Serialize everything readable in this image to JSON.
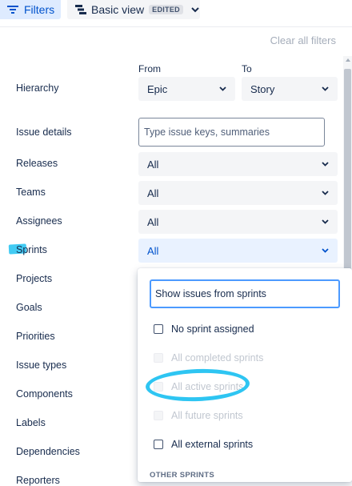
{
  "toolbar": {
    "filters_label": "Filters",
    "view_label": "Basic view",
    "view_badge": "EDITED",
    "filters_icon": "filter-lines-icon",
    "view_icon": "view-bars-icon"
  },
  "clear_all": "Clear all filters",
  "columns": {
    "from": "From",
    "to": "To"
  },
  "hierarchy": {
    "label": "Hierarchy",
    "from_value": "Epic",
    "to_value": "Story"
  },
  "issue_details": {
    "label": "Issue details",
    "placeholder": "Type issue keys, summaries"
  },
  "filters": [
    {
      "label": "Releases",
      "value": "All"
    },
    {
      "label": "Teams",
      "value": "All"
    },
    {
      "label": "Assignees",
      "value": "All"
    },
    {
      "label": "Sprints",
      "value": "All"
    }
  ],
  "more_labels": [
    "Projects",
    "Goals",
    "Priorities",
    "Issue types",
    "Components",
    "Labels",
    "Dependencies",
    "Reporters"
  ],
  "sprint_dropdown": {
    "search_placeholder": "Show issues from sprints",
    "options": [
      {
        "label": "No sprint assigned",
        "disabled": false
      },
      {
        "label": "All completed sprints",
        "disabled": true
      },
      {
        "label": "All active sprints",
        "disabled": true
      },
      {
        "label": "All future sprints",
        "disabled": true
      },
      {
        "label": "All external sprints",
        "disabled": false
      }
    ],
    "section_header": "OTHER SPRINTS"
  },
  "colors": {
    "accent": "#0052cc",
    "selected_bg": "#deebff",
    "annotation": "#2ec5f2"
  }
}
